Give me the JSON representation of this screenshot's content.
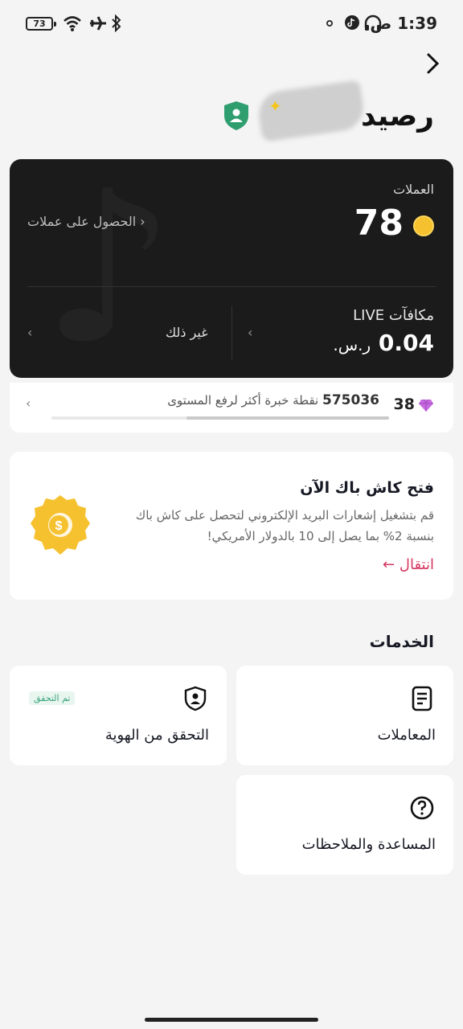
{
  "status_bar": {
    "battery": "73",
    "time": "1:39",
    "am_pm": "ص",
    "icons": [
      "wifi-icon",
      "airplane-icon",
      "bluetooth-icon",
      "headphones-icon",
      "tiktok-icon",
      "settings-dot-icon"
    ]
  },
  "header": {
    "title": "رصيد",
    "back_icon": "chevron-right-icon",
    "verified_icon": "shield-user-icon"
  },
  "balance": {
    "coins_label": "العملات",
    "coins_value": "78",
    "get_coins": "الحصول على عملات",
    "live_label": "مكافآت LIVE",
    "live_value": "0.04",
    "live_currency": "ر.س.",
    "other_label": "غير ذلك"
  },
  "level": {
    "number": "38",
    "points": "575036",
    "points_text": "نقطة خبرة أكثر لرفع المستوى",
    "progress_fraction": 0.6
  },
  "cashback": {
    "title": "فتح كاش باك الآن",
    "description": "قم بتشغيل إشعارات البريد الإلكتروني لتحصل على كاش باك بنسبة 2% بما يصل إلى 10 بالدولار الأمريكي!",
    "link": "انتقال"
  },
  "services": {
    "title": "الخدمات",
    "items": [
      {
        "label": "المعاملات",
        "icon": "document-icon"
      },
      {
        "label": "التحقق من الهوية",
        "icon": "shield-user-icon",
        "tag": "تم التحقق"
      },
      {
        "label": "المساعدة والملاحظات",
        "icon": "help-icon"
      }
    ]
  },
  "colors": {
    "accent": "#d6365f",
    "coin": "#f6c12f",
    "verified_green": "#2f9e6f",
    "card_dark": "#1b1b1b"
  }
}
